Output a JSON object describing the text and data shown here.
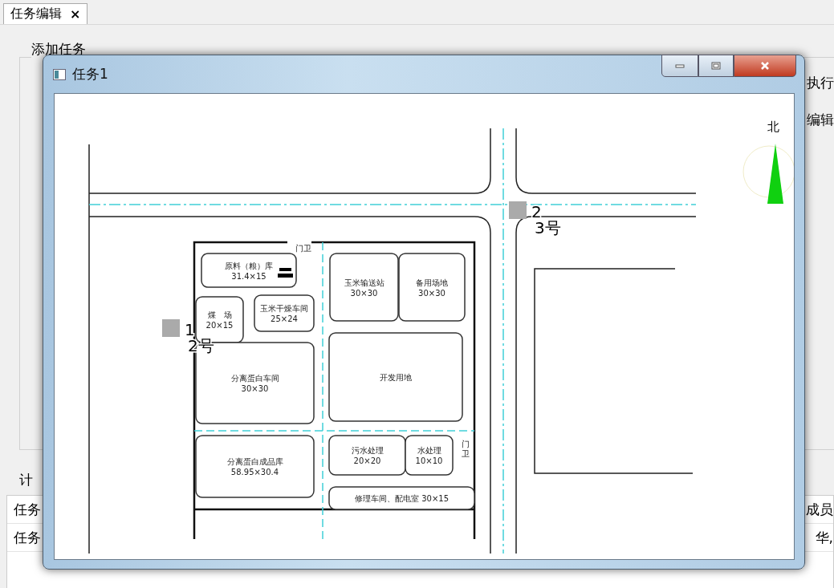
{
  "tab": {
    "label": "任务编辑",
    "close": "×",
    "selected": true
  },
  "background": {
    "group_title": "添加任务",
    "right_labels": [
      "执行",
      "编辑"
    ],
    "section_label": "计",
    "table": {
      "header": [
        "任务",
        "成员"
      ],
      "rows": [
        [
          "任务",
          "华,"
        ]
      ]
    }
  },
  "dialog": {
    "title": "任务1",
    "map": {
      "north": "北",
      "buildings": [
        {
          "lines": [
            "原料（粮）库",
            "31.4×15"
          ]
        },
        {
          "lines": [
            "煤　场",
            "20×15"
          ]
        },
        {
          "lines": [
            "玉米干燥车间",
            "25×24"
          ]
        },
        {
          "lines": [
            "玉米输送站",
            "30×30"
          ]
        },
        {
          "lines": [
            "备用场地",
            "30×30"
          ]
        },
        {
          "lines": [
            "分离蛋白车间",
            "30×30"
          ]
        },
        {
          "lines": [
            "开发用地"
          ]
        },
        {
          "lines": [
            "分离蛋白成品库",
            "58.95×30.4"
          ]
        },
        {
          "lines": [
            "污水处理",
            "20×20"
          ]
        },
        {
          "lines": [
            "水处理",
            "10×10"
          ]
        },
        {
          "lines": [
            "修理车间、配电室 30×15"
          ]
        }
      ],
      "gates": [
        "门卫",
        "门卫"
      ],
      "markers": [
        {
          "number": "1",
          "label": "2号"
        },
        {
          "number": "2",
          "label": "3号"
        }
      ]
    }
  }
}
